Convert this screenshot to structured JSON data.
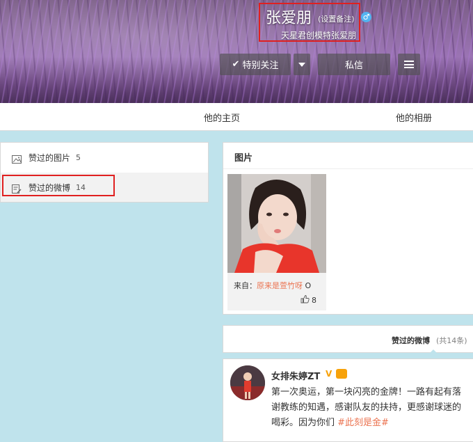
{
  "profile": {
    "name": "张爱朋",
    "remark_link": "(设置备注)",
    "gender_symbol": "♂",
    "description": "天星君创模特张爱朋"
  },
  "actions": {
    "follow_label": "特别关注",
    "follow_check": "✔",
    "message_label": "私信"
  },
  "nav": {
    "home": "他的主页",
    "album": "他的相册"
  },
  "left_menu": {
    "items": [
      {
        "label": "赞过的图片",
        "count": "5"
      },
      {
        "label": "赞过的微博",
        "count": "14"
      }
    ]
  },
  "pictures": {
    "title": "图片",
    "from_label": "来自：",
    "from_user": "原来是萱竹呀",
    "from_suffix": "O",
    "likes": "8"
  },
  "liked_weibo": {
    "title": "赞过的微博",
    "count": "(共14条)"
  },
  "post": {
    "author": "女排朱婷ZT",
    "verified_symbol": "V",
    "lines": [
      "第一次奥运，第一块闪亮的金牌！一路有起有落",
      "谢教练的知遇，感谢队友的扶持，更感谢球迷的",
      "喝彩。因为你们 "
    ],
    "hashtag": "#此刻是金#"
  },
  "colors": {
    "accent_orange": "#eb7350",
    "highlight_red": "#e02020",
    "page_bg": "#bfe3ec",
    "gender_blue": "#53b4f0",
    "verified_gold": "#f7a20a"
  }
}
